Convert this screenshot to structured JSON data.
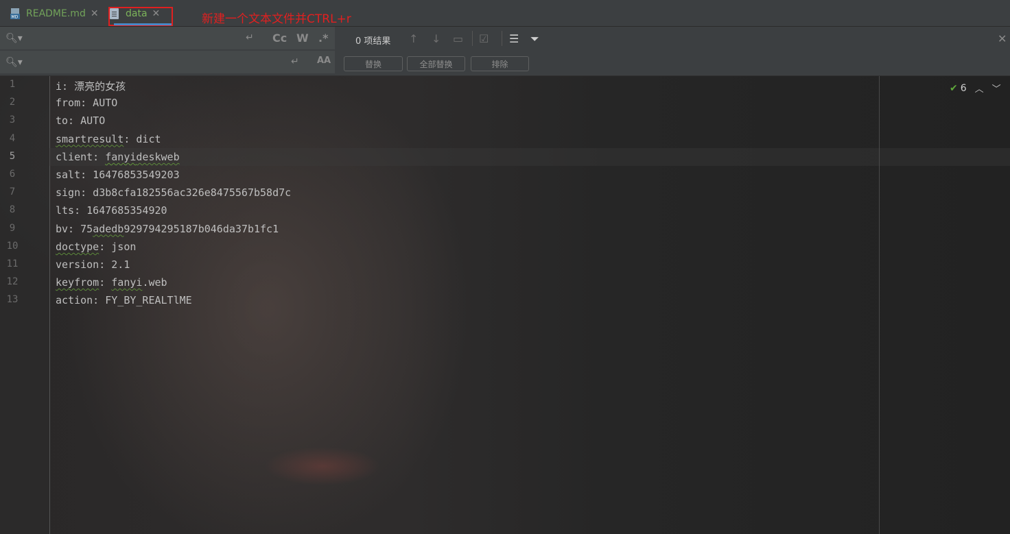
{
  "tabs": [
    {
      "label": "README.md",
      "icon": "markdown-file-icon"
    },
    {
      "label": "data",
      "icon": "text-file-icon",
      "active": true
    }
  ],
  "annotation": "新建一个文本文件并CTRL+r",
  "find": {
    "result_count": "0 项结果",
    "opt_case": "Cc",
    "opt_word": "W",
    "opt_regex": ".*",
    "opt_preserve_case": "AA"
  },
  "replace": {
    "replace_label": "替换",
    "replace_all_label": "全部替换",
    "exclude_label": "排除"
  },
  "inspection": {
    "count": "6"
  },
  "editor": {
    "current_line": 5,
    "line_numbers": [
      "1",
      "2",
      "3",
      "4",
      "5",
      "6",
      "7",
      "8",
      "9",
      "10",
      "11",
      "12",
      "13"
    ],
    "lines": [
      "i: 漂亮的女孩",
      "from: AUTO",
      "to: AUTO",
      "smartresult: dict",
      "client: fanyideskweb",
      "salt: 16476853549203",
      "sign: d3b8cfa182556ac326e8475567b58d7c",
      "lts: 1647685354920",
      "bv: 75adedb929794295187b046da37b1fc1",
      "doctype: json",
      "version: 2.1",
      "keyfrom: fanyi.web",
      "action: FY_BY_REALTlME"
    ]
  },
  "colors": {
    "tab_text_green": "#72a35a",
    "annotation_red": "#e02020",
    "editor_bg": "#2b2b2b",
    "panel_bg": "#3c3f41"
  }
}
